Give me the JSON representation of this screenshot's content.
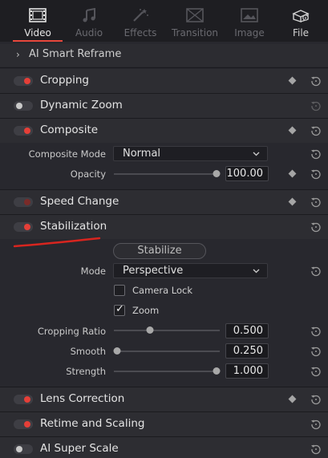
{
  "tabs": [
    {
      "label": "Video",
      "icon": "film-icon",
      "state": "active"
    },
    {
      "label": "Audio",
      "icon": "music-note-icon",
      "state": "disabled"
    },
    {
      "label": "Effects",
      "icon": "magic-wand-icon",
      "state": "disabled"
    },
    {
      "label": "Transition",
      "icon": "transition-icon",
      "state": "disabled"
    },
    {
      "label": "Image",
      "icon": "image-icon",
      "state": "disabled"
    },
    {
      "label": "File",
      "icon": "file-info-icon",
      "state": "enabled"
    }
  ],
  "accent_color": "#e7473c",
  "smart_reframe": {
    "label": "AI Smart Reframe"
  },
  "sections": {
    "cropping": {
      "label": "Cropping",
      "enabled": true
    },
    "dynamic_zoom": {
      "label": "Dynamic Zoom",
      "enabled": false
    },
    "composite": {
      "label": "Composite",
      "enabled": true,
      "mode_label": "Composite Mode",
      "mode_value": "Normal",
      "opacity_label": "Opacity",
      "opacity_value": "100.00",
      "opacity_fraction": 1.0
    },
    "speed_change": {
      "label": "Speed Change",
      "enabled": true
    },
    "stabilization": {
      "label": "Stabilization",
      "enabled": true,
      "stabilize_button": "Stabilize",
      "mode_label": "Mode",
      "mode_value": "Perspective",
      "camera_lock_label": "Camera Lock",
      "camera_lock_checked": false,
      "zoom_label": "Zoom",
      "zoom_checked": true,
      "cropping_ratio_label": "Cropping Ratio",
      "cropping_ratio_value": "0.500",
      "cropping_ratio_fraction": 0.33,
      "smooth_label": "Smooth",
      "smooth_value": "0.250",
      "smooth_fraction": 0.0,
      "strength_label": "Strength",
      "strength_value": "1.000",
      "strength_fraction": 1.0
    },
    "lens_correction": {
      "label": "Lens Correction",
      "enabled": true
    },
    "retime_scaling": {
      "label": "Retime and Scaling",
      "enabled": true
    },
    "ai_super_scale": {
      "label": "AI Super Scale",
      "enabled": false
    }
  },
  "checkmark": "✓",
  "chevron": "›"
}
